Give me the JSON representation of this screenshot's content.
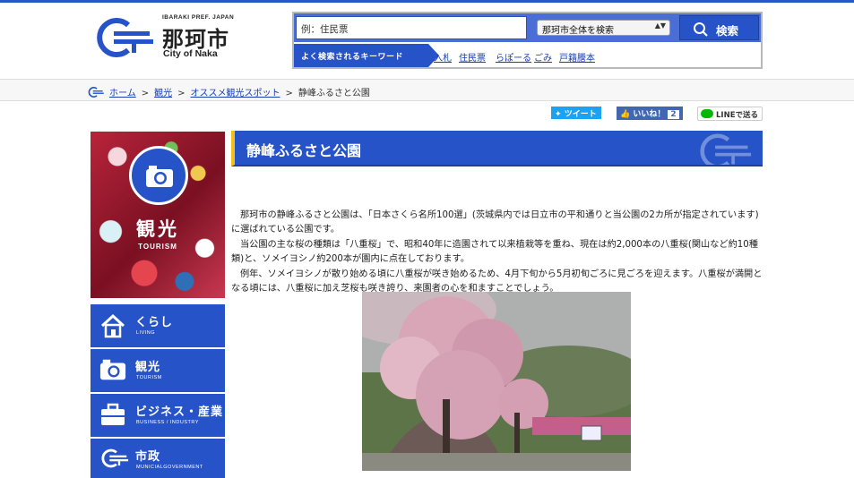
{
  "header": {
    "logo": {
      "pref": "IBARAKI PREF. JAPAN",
      "name_jp": "那珂市",
      "name_en": "City of Naka"
    },
    "search": {
      "placeholder": "例：住民票",
      "scope": "那珂市全体を検索",
      "button_label": "検索",
      "keywords_label": "よく検索されるキーワード",
      "keywords": [
        "入札",
        "住民票",
        "らぽーる",
        "ごみ",
        "戸籍謄本"
      ]
    }
  },
  "breadcrumb": [
    "ホーム",
    "観光",
    "オススメ観光スポット",
    "静峰ふるさと公園"
  ],
  "social": {
    "tweet": "ツイート",
    "like": "いいね！",
    "like_count": "2",
    "line": "LINEで送る"
  },
  "sidebar": {
    "hero": {
      "title": "観光",
      "subtitle": "TOURISM"
    },
    "nav": [
      {
        "label": "くらし",
        "sub": "LIVING",
        "icon": "house-icon"
      },
      {
        "label": "観光",
        "sub": "TOURISM",
        "icon": "camera-icon"
      },
      {
        "label": "ビジネス・産業",
        "sub": "BUSINESS / INDUSTRY",
        "icon": "briefcase-icon"
      },
      {
        "label": "市政",
        "sub": "MUNICIALGOVERNMENT",
        "icon": "city-logo-icon"
      }
    ]
  },
  "main": {
    "title": "静峰ふるさと公園",
    "paragraphs": [
      "那珂市の静峰ふるさと公園は、「日本さくら名所100選」(茨城県内では日立市の平和通りと当公園の2カ所が指定されています)に選ばれている公園です。",
      "当公園の主な桜の種類は「八重桜」で、昭和40年に造園されて以来植栽等を重ね、現在は約2,000本の八重桜(関山など約10種類)と、ソメイヨシノ約200本が園内に点在しております。",
      "例年、ソメイヨシノが散り始める頃に八重桜が咲き始めるため、4月下旬から5月初旬ごろに見ごろを迎えます。八重桜が満開となる頃には、八重桜に加え芝桜も咲き誇り、来園者の心を和ますことでしょう。"
    ]
  },
  "colors": {
    "brand": "#2753c8",
    "accent": "#f0c01b",
    "link": "#1a3fb0"
  }
}
